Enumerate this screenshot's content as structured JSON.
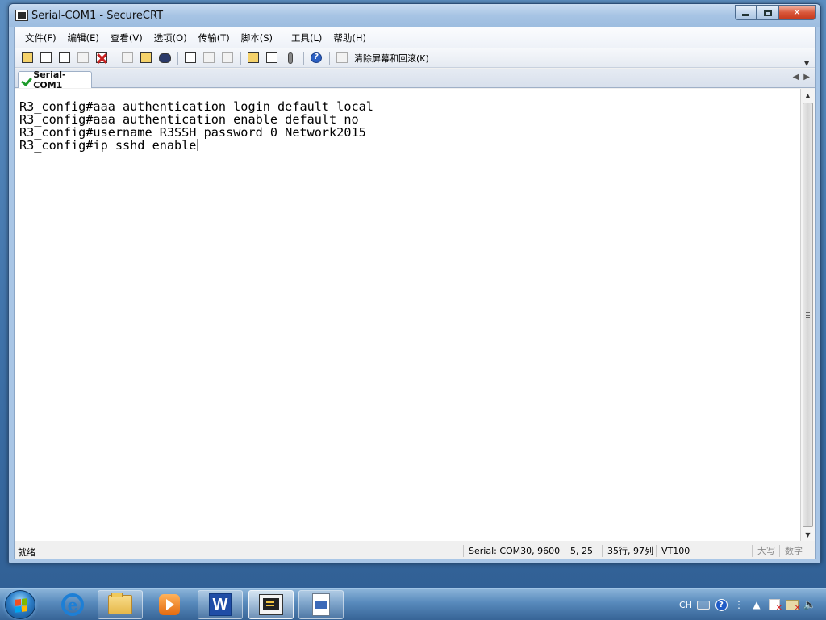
{
  "window": {
    "title": "Serial-COM1 - SecureCRT",
    "controls": {
      "minimize": "",
      "maximize": "",
      "close": "✕"
    }
  },
  "menu": [
    {
      "label": "文件(F)"
    },
    {
      "label": "编辑(E)"
    },
    {
      "label": "查看(V)"
    },
    {
      "label": "选项(O)"
    },
    {
      "label": "传输(T)"
    },
    {
      "label": "脚本(S)"
    },
    {
      "label": "工具(L)"
    },
    {
      "label": "帮助(H)"
    }
  ],
  "toolbar": {
    "icons": [
      "quick-connect-icon",
      "connect-tab-icon",
      "connect-icon",
      "reconnect-icon",
      "disconnect-icon",
      "copy-icon",
      "paste-icon",
      "find-icon",
      "print-setup-icon",
      "print-selection-icon",
      "print-icon",
      "session-options-icon",
      "global-options-icon",
      "keymap-icon",
      "help-icon",
      "clear-scrollback-icon"
    ],
    "clear_label": "清除屏幕和回滚(K)"
  },
  "tabs": [
    {
      "label": "Serial-COM1",
      "status": "connected",
      "active": true
    }
  ],
  "terminal": {
    "lines": [
      "R3_config#aaa authentication login default local",
      "R3_config#aaa authentication enable default no",
      "R3_config#username R3SSH password 0 Network2015",
      "R3_config#ip sshd enable"
    ]
  },
  "statusbar": {
    "ready": "就绪",
    "connection": "Serial: COM30, 9600",
    "cursor": "5,  25",
    "size": "35行, 97列",
    "emulation": "VT100",
    "caps": "大写",
    "num": "数字"
  },
  "taskbar": {
    "apps": [
      "internet-explorer-icon",
      "file-explorer-icon",
      "media-player-icon",
      "word-icon",
      "securecrt-icon",
      "document-viewer-icon"
    ],
    "tray": {
      "language": "CH"
    }
  }
}
